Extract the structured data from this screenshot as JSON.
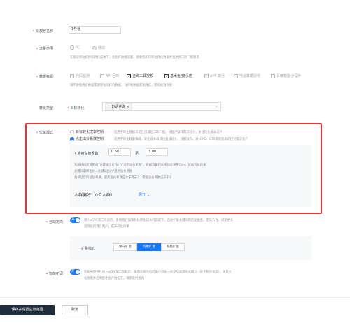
{
  "campaign_name": {
    "label": "投放包名称",
    "value": "1号话"
  },
  "traffic_scope": {
    "label": "流量范围",
    "options": [
      "PC",
      "移动"
    ],
    "hint": "在保证移动端目标转化成本下，优化移动端流量，请要您的转移动转化数据并且达到二阶门槛要求"
  },
  "data_source": {
    "label": "数据来源",
    "options": [
      {
        "label": "代码监测",
        "checked": false
      },
      {
        "label": "API 回传",
        "checked": false
      },
      {
        "label": "咨询工具授权",
        "checked": true
      },
      {
        "label": "基木鱼/度小店",
        "checked": true
      },
      {
        "label": "APP 激活",
        "checked": false
      },
      {
        "label": "电话数据授权",
        "checked": false
      },
      {
        "label": "百度智能小程序",
        "checked": false
      }
    ],
    "hint": "请不要使用多数据来源转化同样的数据，会导致数据重复降低，影响投放效果"
  },
  "conversion_type": {
    "label": "转化类型",
    "sub_label": "目标转化",
    "tag": "一句话咨询"
  },
  "optimize_mode": {
    "label": "优化模式",
    "option1": {
      "label": "目标转化成本控制",
      "desc": "适用于转化数据充足且已满足二阶门槛、对数户操作需求较少，关注转化成本客户"
    },
    "option2": {
      "label": "点击出价系数控制",
      "desc": "适用于转化数量稀疏、转化成本和转化量波动大、频繁操作、对eCPC、CTR等有较高的控制需求客户"
    },
    "coef_label": "适用溢价系数",
    "coef_min": "0.60",
    "coef_to": "至",
    "coef_max": "3.00",
    "notes": [
      "系统将按您设置的\"关键词出价\"结合\"适用溢价系数\"，根据流量转化率动态调整出价，优化转化效果",
      "关键词最终出价=关键词出价*适用溢价系数",
      "为保证您的投放效果，最高溢价系数应大于等于2，最低溢价系数应小于1"
    ],
    "audience_label": "人群偏好（0个人群）",
    "expand_label": "展开"
  },
  "auto_expand": {
    "label": "自动定向",
    "toggle_text": "开",
    "desc": [
      "进入eCPC第二阶段后，系统将在保障目标转化成本的前提下，自动扩展关键词的匹配类型、定向方式、探索更多",
      "高转化的潜在用户，提升转化效果"
    ],
    "mode_label": "扩量模式",
    "modes": [
      "保守扩量",
      "均衡扩量",
      "积极扩量"
    ],
    "active_mode": 1
  },
  "smart_bid": {
    "label": "智能拓词",
    "toggle_text": "开",
    "desc": [
      "智能拓词将在进入eCPC第二阶段后，每周三天为您的账户添加一批新的高转化关键词（处于暂停状态），请您主",
      "动查看并启用后才会开始拓流，请您及时查阅"
    ]
  },
  "footer": {
    "save_label": "保存并设置生效范围",
    "cancel_label": "取消"
  },
  "colors": {
    "accent": "#1677ff",
    "highlight_border": "#e53935"
  }
}
